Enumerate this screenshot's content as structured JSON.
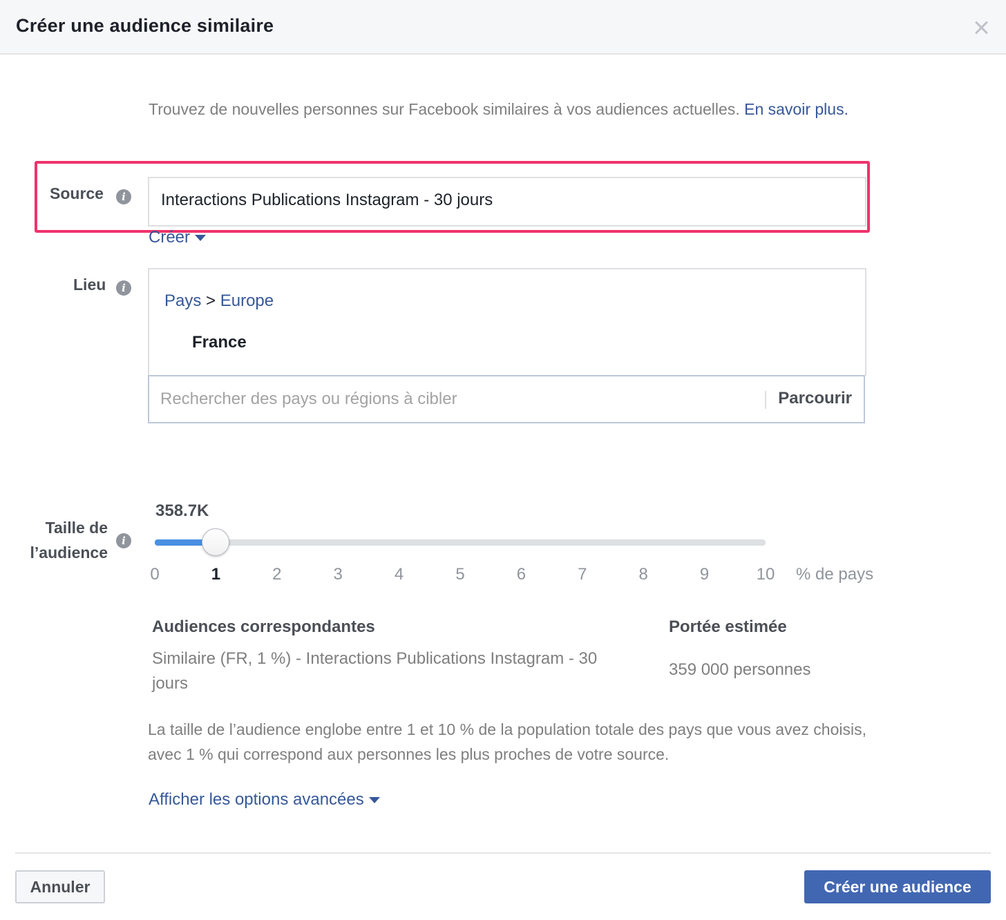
{
  "dialog": {
    "title": "Créer une audience similaire",
    "close_icon": "close-icon"
  },
  "intro": {
    "text": "Trouvez de nouvelles personnes sur Facebook similaires à vos audiences actuelles.",
    "link": "En savoir plus."
  },
  "source": {
    "label": "Source",
    "value": "Interactions Publications Instagram - 30 jours",
    "create_link": "Créer",
    "info_icon": "info-icon",
    "highlight_color": "#f0326c"
  },
  "location": {
    "label": "Lieu",
    "breadcrumb_root": "Pays",
    "breadcrumb_sep": ">",
    "breadcrumb_region": "Europe",
    "selected_country": "France",
    "search_placeholder": "Rechercher des pays ou régions à cibler",
    "browse_label": "Parcourir"
  },
  "audience_size": {
    "label_line1": "Taille de",
    "label_line2": "l’audience",
    "value": "358.7K",
    "selected_percent": 1,
    "max_percent": 10,
    "ticks": [
      "0",
      "1",
      "2",
      "3",
      "4",
      "5",
      "6",
      "7",
      "8",
      "9",
      "10"
    ],
    "unit": "% de pays",
    "accent": "#4a90e2"
  },
  "results": {
    "matching_header": "Audiences correspondantes",
    "matching_value": "Similaire (FR, 1 %) - Interactions Publications Instagram - 30 jours",
    "reach_header": "Portée estimée",
    "reach_value": "359 000 personnes"
  },
  "explanation": "La taille de l’audience englobe entre 1 et 10 % de la population totale des pays que vous avez choisis, avec 1 % qui correspond aux personnes les plus proches de votre source.",
  "advanced_link": "Afficher les options avancées",
  "footer": {
    "cancel_label": "Annuler",
    "create_label": "Créer une audience",
    "primary_color": "#4267b2"
  }
}
